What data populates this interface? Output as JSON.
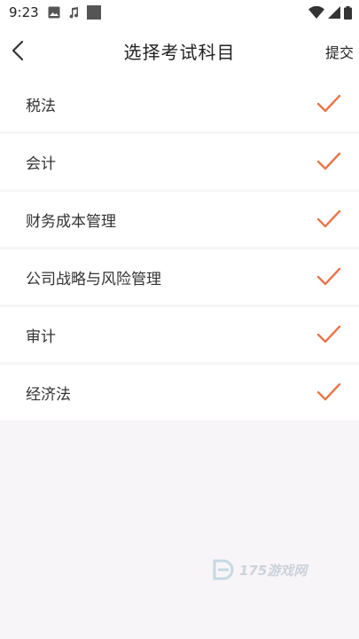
{
  "status_bar": {
    "time": "9:23",
    "icons": [
      "image-icon",
      "music-note-icon",
      "square-icon"
    ],
    "right_icons": [
      "wifi-icon",
      "signal-icon",
      "battery-icon"
    ]
  },
  "header": {
    "title": "选择考试科目",
    "submit_label": "提交"
  },
  "subjects": [
    {
      "label": "税法",
      "selected": true
    },
    {
      "label": "会计",
      "selected": true
    },
    {
      "label": "财务成本管理",
      "selected": true
    },
    {
      "label": "公司战略与风险管理",
      "selected": true
    },
    {
      "label": "审计",
      "selected": true
    },
    {
      "label": "经济法",
      "selected": true
    }
  ],
  "watermark": {
    "text": "175游戏网"
  },
  "colors": {
    "accent": "#e8764a",
    "background": "#f7f5f7"
  }
}
